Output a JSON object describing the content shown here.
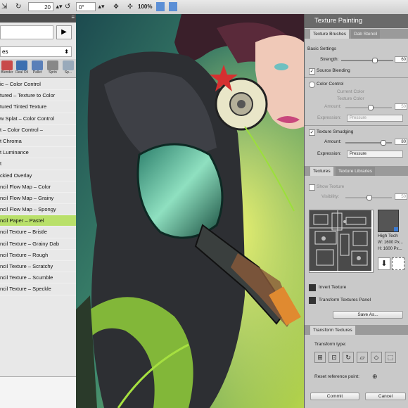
{
  "toolbar": {
    "field1_value": "20",
    "field2_value": "0°",
    "zoom": "100%"
  },
  "left_panel": {
    "category": "es",
    "brush_thumbs": [
      "Blender",
      "Real Oil",
      "Pallet",
      "Sprin",
      "Sp..."
    ],
    "brushes": [
      "ic – Color Control",
      "tured – Texture to Color",
      "tured Tinted Texture",
      "w Splat – Color Control",
      "t – Color Control –",
      "t Chroma",
      "t Luminance",
      "t",
      "ckled Overlay",
      "ncil Flow Map – Color",
      "ncil Flow Map – Grainy",
      "ncil Flow Map – Spongy",
      "ncil Paper – Pastel",
      "ncil Texture – Bristle",
      "ncil Texture – Grainy Dab",
      "ncil Texture – Rough",
      "ncil Texture – Scratchy",
      "ncil Texture – Scumble",
      "ncil Texture – Speckle"
    ],
    "selected_index": 12
  },
  "right_panel": {
    "title": "Texture Painting",
    "tabs1": [
      "Texture Brushes",
      "Dab Stencil"
    ],
    "basic_settings": "Basic Settings",
    "strength_label": "Strength:",
    "strength_value": "60",
    "source_blending": "Source Blending",
    "color_control": "Color Control",
    "current_color": "Current Color",
    "texture_color": "Texture Color",
    "amount_label": "Amount:",
    "amount_value": "50",
    "expression_label": "Expression:",
    "expression_value": "Pressure",
    "texture_smudging": "Texture Smudging",
    "amount2_value": "80",
    "tabs2": [
      "Textures",
      "Texture Libraries"
    ],
    "show_texture": "Show Texture",
    "visibility_label": "Visibility:",
    "visibility_value": "50",
    "texture_name": "High Tech",
    "texture_w": "W: 1600 Px...",
    "texture_h": "H: 1600 Px...",
    "invert_texture": "Invert Texture",
    "transform_textures_panel": "Transform Textures Panel",
    "save_as": "Save As...",
    "transform_tab": "Transform Textures",
    "transform_type": "Transform type:",
    "reset_ref": "Reset reference point:",
    "commit": "Commit",
    "cancel": "Cancel"
  }
}
